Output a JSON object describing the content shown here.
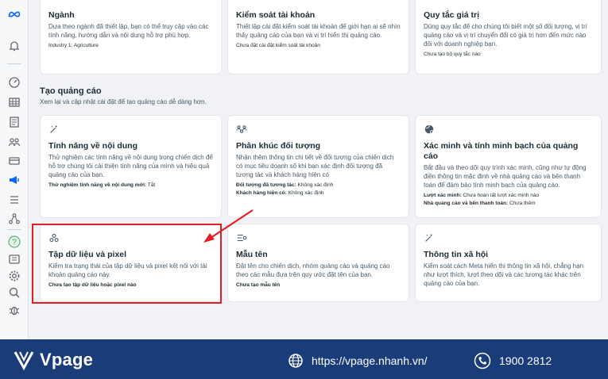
{
  "sidebar": {
    "icons": [
      "meta-logo-icon",
      "bell-icon",
      "dashboard-icon",
      "table-icon",
      "pages-icon",
      "audience-icon",
      "billing-icon",
      "ads-manager-icon",
      "menu-icon",
      "share-icon",
      "help-icon",
      "news-icon",
      "settings-icon",
      "search-icon",
      "bug-icon"
    ]
  },
  "top_cards": [
    {
      "title": "Ngành",
      "desc": "Dựa theo ngành đã thiết lập, bạn có thể truy cập vào các tính năng, hướng dẫn và nội dung hỗ trợ phù hợp.",
      "meta_label": "Industry 1:",
      "meta_value": "Agriculture"
    },
    {
      "title": "Kiểm soát tài khoản",
      "desc": "Thiết lập cài đặt kiểm soát tài khoản để giới hạn ai sẽ nhìn thấy quảng cáo của bạn và vị trí hiển thị quảng cáo.",
      "meta_label": "",
      "meta_value": "Chưa đặt cài đặt kiểm soát tài khoản"
    },
    {
      "title": "Quy tắc giá trị",
      "desc": "Dùng quy tắc để cho chúng tôi biết một số đối tượng, vị trí quảng cáo và vị trí chuyển đổi có giá trị hơn đến mức nào đối với doanh nghiệp bạn.",
      "meta_label": "",
      "meta_value": "Chưa tạo bộ quy tắc nào"
    }
  ],
  "section": {
    "title": "Tạo quảng cáo",
    "subtitle": "Xem lại và cập nhật cài đặt để tạo quảng cáo dễ dàng hơn."
  },
  "cards": [
    {
      "title": "Tính năng về nội dung",
      "desc": "Thử nghiệm các tính năng về nội dung trong chiến dịch để hỗ trợ chúng tôi cải thiện tính năng của mình và hiệu quả quảng cáo của bạn.",
      "meta": [
        {
          "label": "Thử nghiệm tính năng về nội dung mới:",
          "value": "Tắt"
        }
      ]
    },
    {
      "title": "Phân khúc đối tượng",
      "desc": "Nhận thêm thông tin chi tiết về đối tượng của chiến dịch có mục tiêu doanh số khi bạn xác định đối tượng đã tương tác và khách hàng hiện có",
      "meta": [
        {
          "label": "Đối tượng đã tương tác:",
          "value": "Không xác định"
        },
        {
          "label": "Khách hàng hiện có:",
          "value": "Không xác định"
        }
      ]
    },
    {
      "title": "Xác minh và tính minh bạch của quảng cáo",
      "desc": "Bắt đầu và theo dõi quy trình xác minh, cũng như tự động điền thông tin mặc định về nhà quảng cáo và bên thanh toán để đảm bảo tính minh bạch của quảng cáo.",
      "meta": [
        {
          "label": "Lượt xác minh:",
          "value": "Chưa hoàn tất lượt xác minh nào"
        },
        {
          "label": "Nhà quảng cáo và bên thanh toán:",
          "value": "Chưa thêm"
        }
      ]
    },
    {
      "title": "Tập dữ liệu và pixel",
      "desc": "Kiểm tra trạng thái của tập dữ liệu và pixel kết nối với tài khoản quảng cáo này.",
      "meta": [
        {
          "label": "",
          "value": "Chưa tạo tập dữ liệu hoặc pixel nào"
        }
      ]
    },
    {
      "title": "Mẫu tên",
      "desc": "Đặt tên cho chiến dịch, nhóm quảng cáo và quảng cáo theo các mẫu đưa trên quy ước đặt tên của bạn.",
      "meta": [
        {
          "label": "",
          "value": "Chưa tạo mẫu tên"
        }
      ]
    },
    {
      "title": "Thông tin xã hội",
      "desc": "Kiểm soát cách Meta hiển thị thông tin xã hội, chẳng hạn như lượt thích, lượt theo dõi và các tương tác khác trên quảng cáo của bạn.",
      "meta": []
    }
  ],
  "footer": {
    "brand": "Vpage",
    "url": "https://vpage.nhanh.vn/",
    "phone": "1900 2812"
  },
  "colors": {
    "highlight": "#e01e24",
    "footer_bg": "#1a3d7a",
    "ads_manager_active": "#0866ff"
  }
}
